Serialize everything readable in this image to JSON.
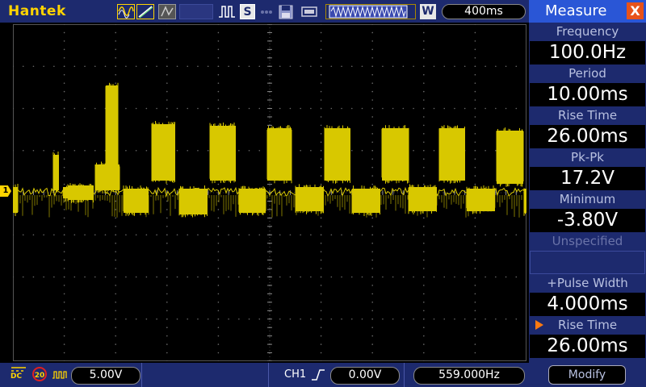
{
  "app": {
    "brand": "Hantek"
  },
  "toolbar": {
    "save_mode_label": "S",
    "waveform_label": "W",
    "timebase": "400ms"
  },
  "channel1": {
    "marker": "1",
    "coupling": "DC",
    "bw_limit": "20",
    "volts_per_div": "5.00V"
  },
  "trigger": {
    "source": "CH1",
    "edge": "rising",
    "level": "0.00V",
    "frequency": "559.000Hz"
  },
  "measure_panel": {
    "title": "Measure",
    "close_label": "X",
    "slots": [
      {
        "label": "Frequency",
        "value": "100.0Hz"
      },
      {
        "label": "Period",
        "value": "10.00ms"
      },
      {
        "label": "Rise Time",
        "value": "26.00ms"
      },
      {
        "label": "Pk-Pk",
        "value": "17.2V"
      },
      {
        "label": "Minimum",
        "value": "-3.80V"
      },
      {
        "label": "Unspecified",
        "value": ""
      },
      {
        "label": "+Pulse Width",
        "value": "4.000ms"
      },
      {
        "label": "Rise Time",
        "value": "26.00ms",
        "selected": true
      }
    ],
    "modify_label": "Modify"
  },
  "colors": {
    "trace": "#d8c800",
    "toolbar_bg": "#1d2a6e",
    "panel_header": "#2a56d6",
    "close_button": "#e8521a",
    "selection_arrow": "#ff7a10"
  }
}
